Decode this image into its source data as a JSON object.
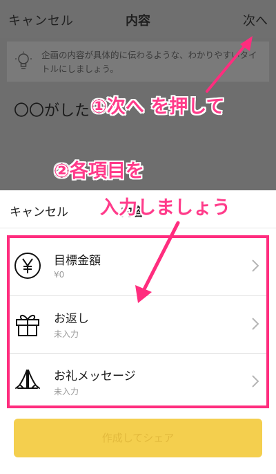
{
  "topbar": {
    "cancel_label": "キャンセル",
    "title": "内容",
    "next_label": "次へ"
  },
  "hint": {
    "text": "企画の内容が具体的に伝わるような、わかりやすいタイトルにしましょう。"
  },
  "title_input": {
    "value": "〇〇がした"
  },
  "callouts": {
    "step1": "①次へ を押して",
    "step2_line1": "②各項目を",
    "step2_line2": "入力しましょう"
  },
  "sheet": {
    "cancel_label": "キャンセル",
    "title": "内容",
    "items": [
      {
        "label": "目標金額",
        "value": "¥0",
        "icon": "yen-circle-icon"
      },
      {
        "label": "お返し",
        "value": "未入力",
        "icon": "gift-icon"
      },
      {
        "label": "お礼メッセージ",
        "value": "未入力",
        "icon": "praying-hands-icon"
      }
    ]
  },
  "share_button": {
    "label": "作成してシェア"
  },
  "colors": {
    "highlight": "#ff2d7e",
    "button": "#f4cf4e",
    "overlay": "#6e6e6e"
  }
}
